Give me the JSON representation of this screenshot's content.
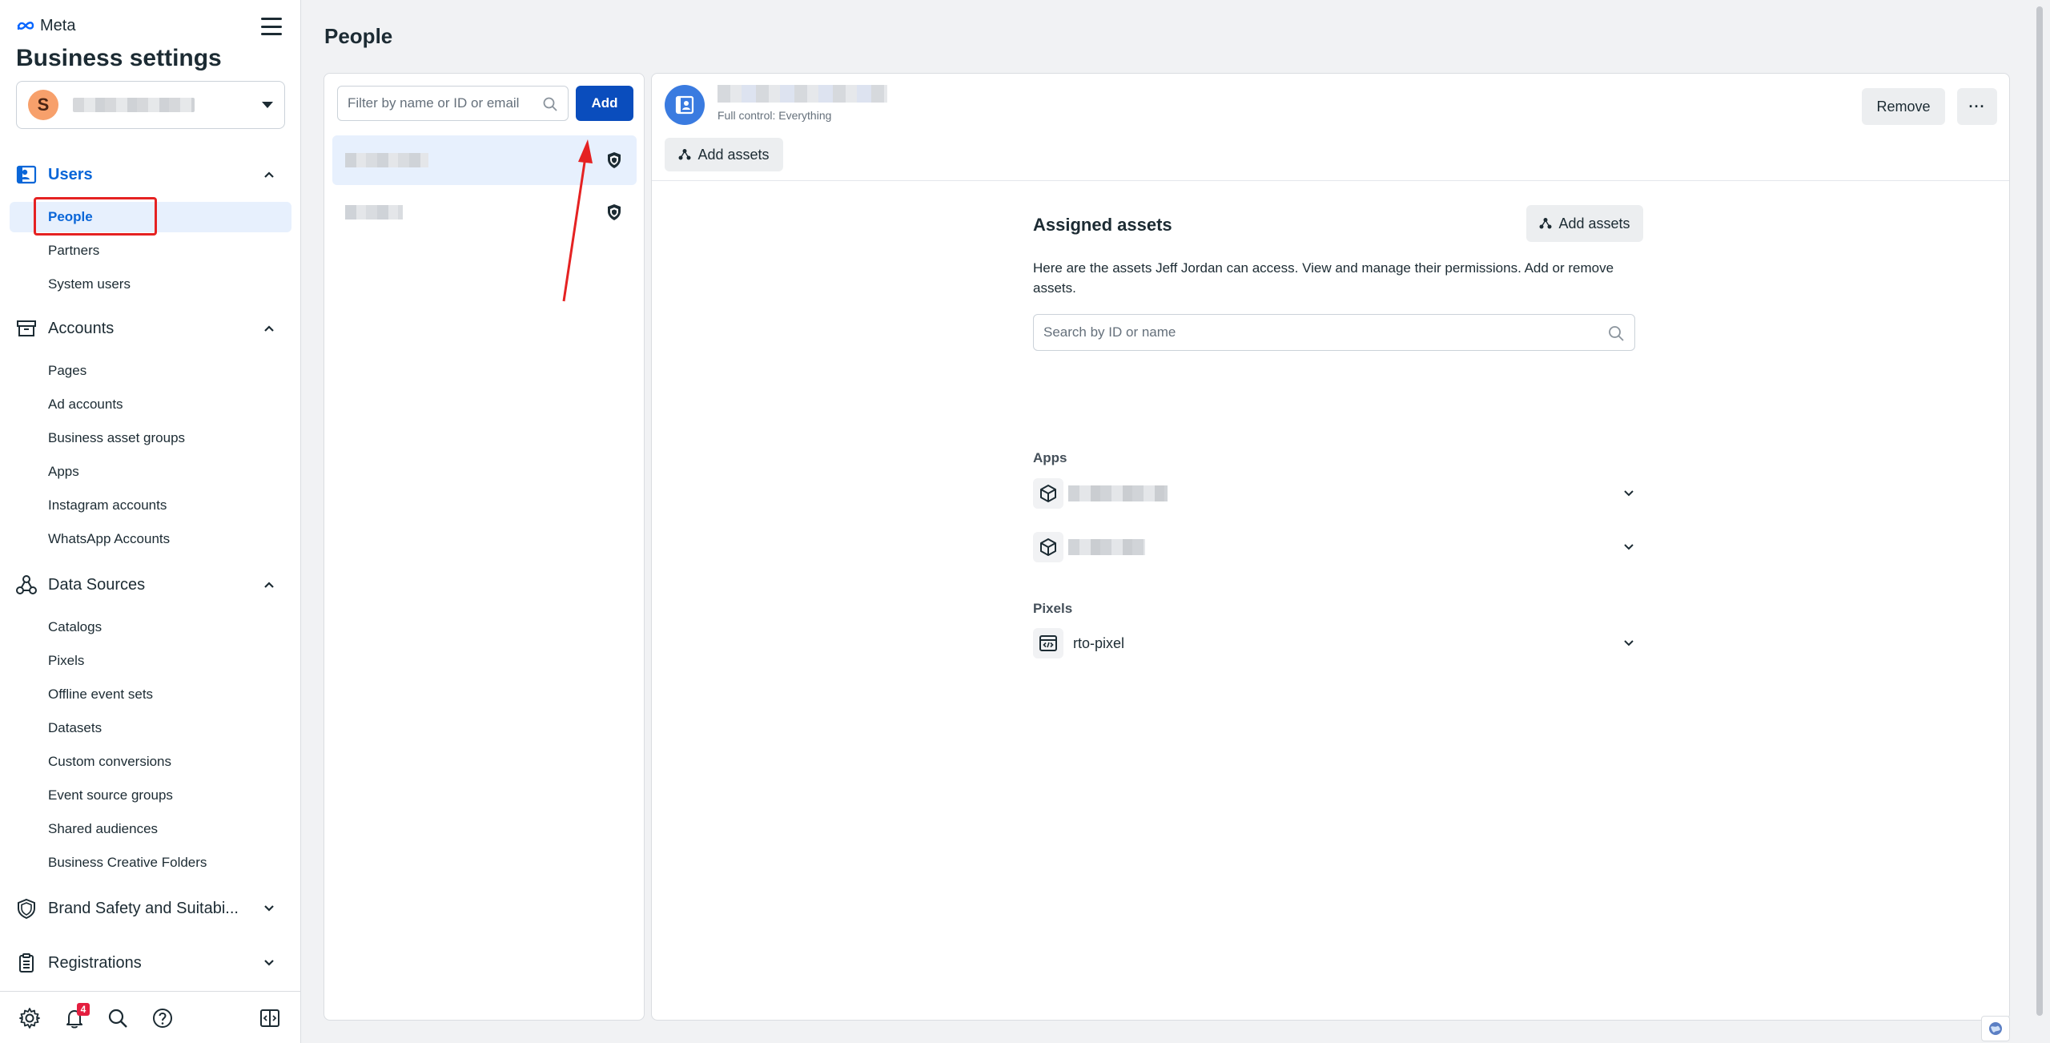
{
  "brand": {
    "logo_text": "Meta",
    "app_title": "Business settings"
  },
  "business": {
    "avatar_letter": "S"
  },
  "sidebar": {
    "sections": {
      "users": {
        "label": "Users",
        "items": [
          "People",
          "Partners",
          "System users"
        ]
      },
      "accounts": {
        "label": "Accounts",
        "items": [
          "Pages",
          "Ad accounts",
          "Business asset groups",
          "Apps",
          "Instagram accounts",
          "WhatsApp Accounts"
        ]
      },
      "data_sources": {
        "label": "Data Sources",
        "items": [
          "Catalogs",
          "Pixels",
          "Offline event sets",
          "Datasets",
          "Custom conversions",
          "Event source groups",
          "Shared audiences",
          "Business Creative Folders"
        ]
      },
      "brand_safety": {
        "label": "Brand Safety and Suitabi..."
      },
      "registrations": {
        "label": "Registrations"
      }
    },
    "footer": {
      "notification_count": "4"
    }
  },
  "page": {
    "title": "People"
  },
  "people_panel": {
    "filter_placeholder": "Filter by name or ID or email",
    "add_label": "Add"
  },
  "detail": {
    "role": "Full control: Everything",
    "remove_label": "Remove",
    "more_label": "···",
    "add_assets_label": "Add assets",
    "assigned": {
      "title": "Assigned assets",
      "add_assets_label": "Add assets",
      "description": "Here are the assets Jeff Jordan can access. View and manage their permissions. Add or remove assets.",
      "search_placeholder": "Search by ID or name",
      "apps_label": "Apps",
      "pixels_label": "Pixels",
      "pixels": [
        "rto-pixel"
      ]
    }
  },
  "colors": {
    "accent": "#0a66d8",
    "primary_button": "#0a4dbd",
    "annotation": "#e52222"
  }
}
